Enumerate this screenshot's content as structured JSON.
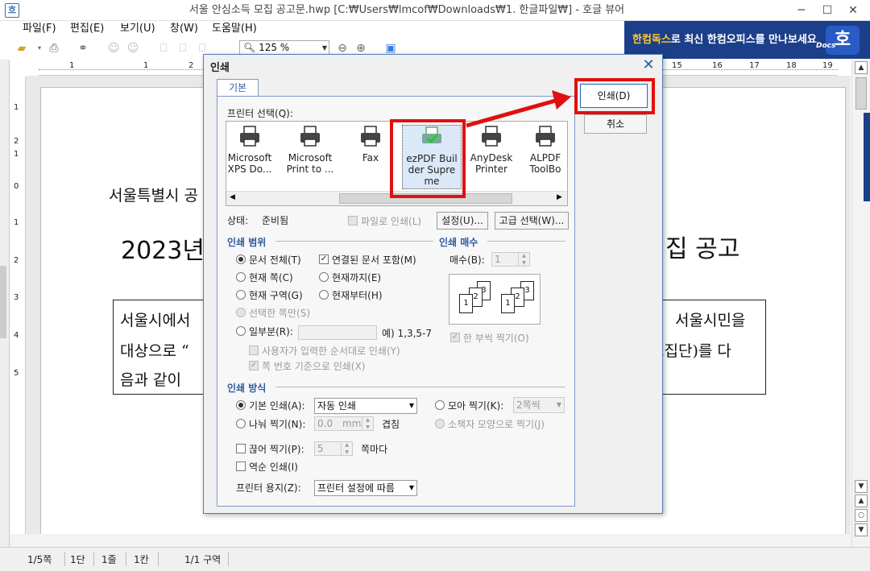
{
  "window": {
    "app_icon": "흐",
    "title": "서울 안심소득 모집 공고문.hwp [C:₩Users₩lmcof₩Downloads₩1. 한글파일₩] - 호글 뷰어",
    "minimize": "─",
    "maximize": "☐",
    "close": "✕"
  },
  "menu": [
    "파일(F)",
    "편집(E)",
    "보기(U)",
    "창(W)",
    "도움말(H)"
  ],
  "toolbar": {
    "zoom": "125 %"
  },
  "ad": {
    "highlight": "한컴독스",
    "text": "로 최신 한컴오피스를 만나보세요",
    "logo": "호",
    "docs": "Docs"
  },
  "ruler_numbers": [
    "1",
    "1",
    "2",
    "15",
    "16",
    "17",
    "18",
    "19"
  ],
  "vruler_numbers": [
    "1",
    "2",
    "1",
    "0",
    "1",
    "2",
    "3",
    "4",
    "5"
  ],
  "document": {
    "line1": "서울특별시 공",
    "heading_left": "2023년",
    "heading_right": "집 공고",
    "box_line1_left": "서울시에서",
    "box_line1_right": "서울시민을",
    "box_line2_left": "대상으로 “",
    "box_line2_right": "교집단)를 다",
    "box_line3_left": "음과 같이"
  },
  "status": [
    "1/5쪽",
    "1단",
    "1줄",
    "1칸",
    "1/1 구역"
  ],
  "dialog": {
    "title": "인쇄",
    "close": "✕",
    "tab": "기본",
    "printer_select_label": "프린터 선택(Q):",
    "printers": [
      {
        "name": "Microsoft XPS Do...",
        "icon": "printer-icon"
      },
      {
        "name": "Microsoft Print to ...",
        "icon": "printer-icon"
      },
      {
        "name": "Fax",
        "icon": "printer-icon"
      },
      {
        "name": "ezPDF Builder Supreme",
        "icon": "pdf-printer-icon"
      },
      {
        "name": "AnyDesk Printer",
        "icon": "printer-icon"
      },
      {
        "name": "ALPDF ToolBo",
        "icon": "printer-icon"
      }
    ],
    "printer_names": {
      "p1a": "Microsoft",
      "p1b": "XPS Do...",
      "p2a": "Microsoft",
      "p2b": "Print to ...",
      "p3a": "Fax",
      "p4a": "ezPDF Buil",
      "p4b": "der Supre",
      "p4c": "me",
      "p5a": "AnyDesk",
      "p5b": "Printer",
      "p6a": "ALPDF",
      "p6b": "ToolBo"
    },
    "scroll_left": "◀",
    "scroll_right": "▶",
    "status_label": "상태:",
    "status_value": "준비됨",
    "print_to_file": "파일로 인쇄(L)",
    "settings_button": "설정(U)...",
    "advanced_button": "고급 선택(W)...",
    "range_section": "인쇄 범위",
    "range_all": "문서 전체(T)",
    "range_linked": "연결된 문서 포함(M)",
    "range_current_page": "현재 쪽(C)",
    "range_to_current": "현재까지(E)",
    "range_current_section": "현재 구역(G)",
    "range_from_current": "현재부터(H)",
    "range_selected": "선택한 쪽만(S)",
    "range_partial": "일부분(R):",
    "range_partial_example": "예) 1,3,5-7",
    "range_user_order": "사용자가 입력한 순서대로 인쇄(Y)",
    "range_page_number": "쪽 번호 기준으로 인쇄(X)",
    "copies_section": "인쇄 매수",
    "copies_label": "매수(B):",
    "copies_value": "1",
    "collate": "한 부씩 찍기(O)",
    "copies_pages": [
      "1",
      "2",
      "3",
      "1",
      "2",
      "3"
    ],
    "method_section": "인쇄 방식",
    "method_basic": "기본 인쇄(A):",
    "method_basic_value": "자동 인쇄",
    "method_gather": "모아 찍기(K):",
    "method_gather_value": "2쪽씩",
    "method_split": "나눠 찍기(N):",
    "method_split_value": "0.0",
    "method_split_unit": "mm",
    "method_overlap": "겹침",
    "method_booklet": "소책자 모양으로 찍기(J)",
    "method_cut": "끊어 찍기(P):",
    "method_cut_value": "5",
    "method_cut_suffix": "쪽마다",
    "method_reverse": "역순 인쇄(I)",
    "paper_label": "프린터 용지(Z):",
    "paper_value": "프린터 설정에 따름",
    "print_button": "인쇄(D)",
    "cancel_button": "취소"
  },
  "colors": {
    "highlight_red": "#e01010",
    "accent_blue": "#2d5a9e",
    "ad_bg": "#1c3f8a"
  }
}
